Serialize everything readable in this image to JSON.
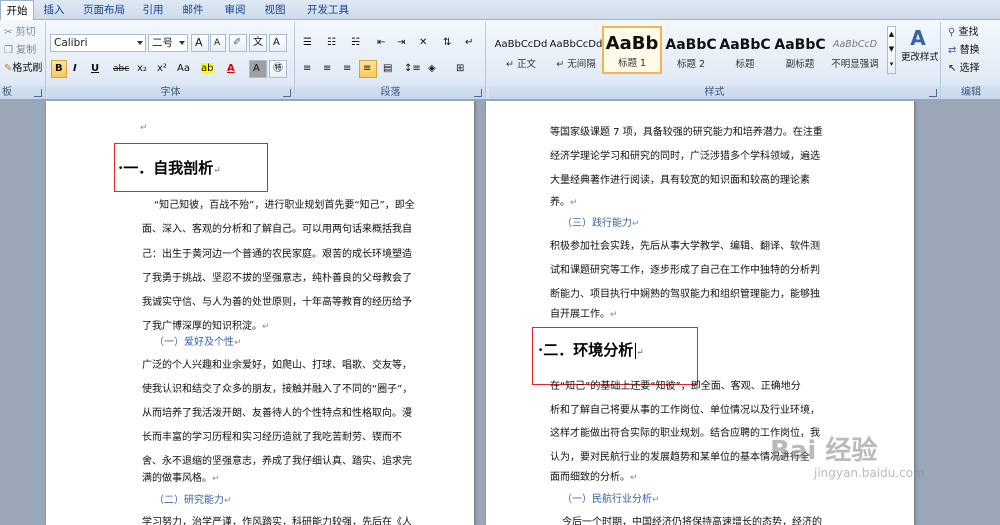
{
  "tabs": [
    "开始",
    "插入",
    "页面布局",
    "引用",
    "邮件",
    "审阅",
    "视图",
    "开发工具"
  ],
  "clipboard": {
    "cut": "剪切",
    "copy": "复制",
    "format_painter": "格式刷",
    "label": "板"
  },
  "font": {
    "name": "Calibri",
    "size": "二号",
    "grow": "A",
    "shrink": "A",
    "aa": "Aa",
    "bold": "B",
    "italic": "I",
    "underline": "U",
    "strike": "abc",
    "subscript": "x₂",
    "superscript": "x²",
    "font_color": "A",
    "label": "字体"
  },
  "paragraph": {
    "label": "段落"
  },
  "styles": {
    "items": [
      {
        "sample": "AaBbCcDd",
        "name": "↵ 正文"
      },
      {
        "sample": "AaBbCcDd",
        "name": "↵ 无间隔"
      },
      {
        "sample": "AaBb",
        "name": "标题 1"
      },
      {
        "sample": "AaBbC",
        "name": "标题 2"
      },
      {
        "sample": "AaBbC",
        "name": "标题"
      },
      {
        "sample": "AaBbC",
        "name": "副标题"
      },
      {
        "sample": "AaBbCcD",
        "name": "不明显强调"
      }
    ],
    "change_styles": "更改样式",
    "label": "样式"
  },
  "editing": {
    "find": "查找",
    "replace": "替换",
    "select": "选择",
    "label": "编辑"
  },
  "left_page": {
    "heading": "·一．自我剖析",
    "para1": [
      "“知己知彼，百战不殆”，进行职业规划首先要“知己”，即全",
      "面、深入、客观的分析和了解自己。可以用两句话来概括我自",
      "己：出生于黄河边一个普通的农民家庭。艰苦的成长环境塑造",
      "了我勇于挑战、坚忍不拔的坚强意志，纯朴善良的父母教会了",
      "我诚实守信、与人为善的处世原则，十年高等教育的经历给予",
      "了我广博深厚的知识积淀。"
    ],
    "sub1": "（一）爱好及个性",
    "para2": [
      "广泛的个人兴趣和业余爱好，如爬山、打球、唱歌、交友等，",
      "使我认识和结交了众多的朋友，接触并融入了不同的“圈子”，",
      "从而培养了我活泼开朗、友善待人的个性特点和性格取向。漫",
      "长而丰富的学习历程和实习经历造就了我吃苦耐劳、锲而不",
      "舍、永不退缩的坚强意志，养成了我仔细认真、踏实、追求完",
      "满的做事风格。"
    ],
    "sub2": "（二）研究能力",
    "para3": [
      "学习努力，治学严谨，作风踏实，科研能力较强，先后在《人"
    ]
  },
  "right_page": {
    "para1": [
      "等国家级课题 7 项，具备较强的研究能力和培养潜力。在注重",
      "经济学理论学习和研究的同时，广泛涉猎多个学科领域，遍选",
      "大量经典著作进行阅读，具有较宽的知识面和较高的理论素",
      "养。"
    ],
    "sub1": "（三）践行能力",
    "para2": [
      "积极参加社会实践，先后从事大学教学、编辑、翻译、软件测",
      "试和课题研究等工作，逐步形成了自己在工作中独特的分析判",
      "断能力、项目执行中娴熟的驾驭能力和组织管理能力，能够独",
      "自开展工作。"
    ],
    "heading": "·二．环境分析",
    "para3": [
      "在“知己”的基础上还要“知彼”，即全面、客观、正确地分",
      "析和了解自己将要从事的工作岗位、单位情况以及行业环境，",
      "这样才能做出符合实际的职业规划。结合应聘的工作岗位，我",
      "认为，要对民航行业的发展趋势和某单位的基本情况进行全",
      "面而细致的分析。"
    ],
    "sub2": "（一）民航行业分析",
    "para4": [
      "今后一个时期，中国经济仍将保持高速增长的态势，经济的"
    ]
  },
  "watermark": {
    "text": "Bai  经验",
    "url": "jingyan.baidu.com"
  },
  "colors": {
    "accent": "#15428b",
    "heading_blue": "#3a62a8",
    "highlight_red": "#e0262b"
  }
}
